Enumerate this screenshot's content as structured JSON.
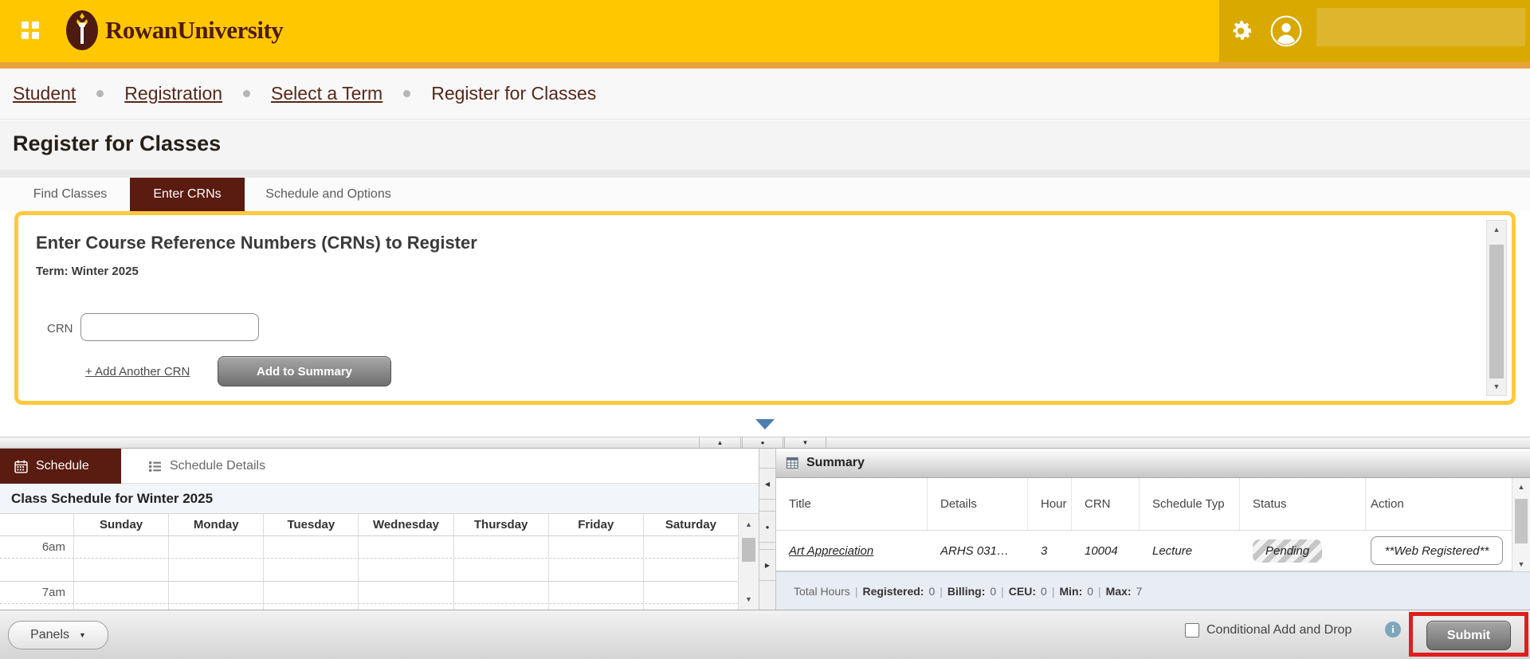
{
  "header": {
    "logo_text": "RowanUniversity"
  },
  "breadcrumb": {
    "items": [
      {
        "label": "Student"
      },
      {
        "label": "Registration"
      },
      {
        "label": "Select a Term"
      },
      {
        "label": "Register for Classes"
      }
    ]
  },
  "page": {
    "title": "Register for Classes"
  },
  "tabs": {
    "find_classes": "Find Classes",
    "enter_crns": "Enter CRNs",
    "schedule_options": "Schedule and Options"
  },
  "crn_panel": {
    "heading": "Enter Course Reference Numbers (CRNs) to Register",
    "term": "Term: Winter 2025",
    "crn_label": "CRN",
    "crn_value": "",
    "add_another": "+ Add Another CRN",
    "add_to_summary": "Add to Summary"
  },
  "schedule": {
    "tab_schedule": "Schedule",
    "tab_details": "Schedule Details",
    "title": "Class Schedule for Winter 2025",
    "days": [
      "Sunday",
      "Monday",
      "Tuesday",
      "Wednesday",
      "Thursday",
      "Friday",
      "Saturday"
    ],
    "times": [
      "6am",
      "7am"
    ]
  },
  "summary": {
    "title": "Summary",
    "columns": [
      "Title",
      "Details",
      "Hour",
      "CRN",
      "Schedule Typ",
      "Status",
      "Action"
    ],
    "row": {
      "title": "Art Appreciation",
      "details": "ARHS 031…",
      "hours": "3",
      "crn": "10004",
      "schedule_type": "Lecture",
      "status": "Pending",
      "action": "**Web Registered**"
    },
    "totals": {
      "prefix": "Total Hours",
      "sep": "|",
      "items": [
        {
          "label": "Registered:",
          "value": "0"
        },
        {
          "label": "Billing:",
          "value": "0"
        },
        {
          "label": "CEU:",
          "value": "0"
        },
        {
          "label": "Min:",
          "value": "0"
        },
        {
          "label": "Max:",
          "value": "7"
        }
      ]
    }
  },
  "bottom_bar": {
    "panels": "Panels",
    "conditional": "Conditional Add and Drop",
    "info": "i",
    "submit": "Submit"
  },
  "glyphs": {
    "up": "▲",
    "down": "▼",
    "left": "◀",
    "right": "▶",
    "dot": "●"
  },
  "colors": {
    "header_yellow": "#FEC700",
    "header_right_yellow": "#D9A900",
    "orange_strip": "#E9A23B",
    "maroon": "#5A1B10",
    "logo_maroon": "#4E1B12",
    "panel_border_gold": "#FFC83D",
    "link_maroon": "#56281A",
    "collapse_triangle_blue": "#4E7CB0",
    "highlight_red": "#DE1E1E",
    "totals_bar": "#E8EDF3"
  }
}
